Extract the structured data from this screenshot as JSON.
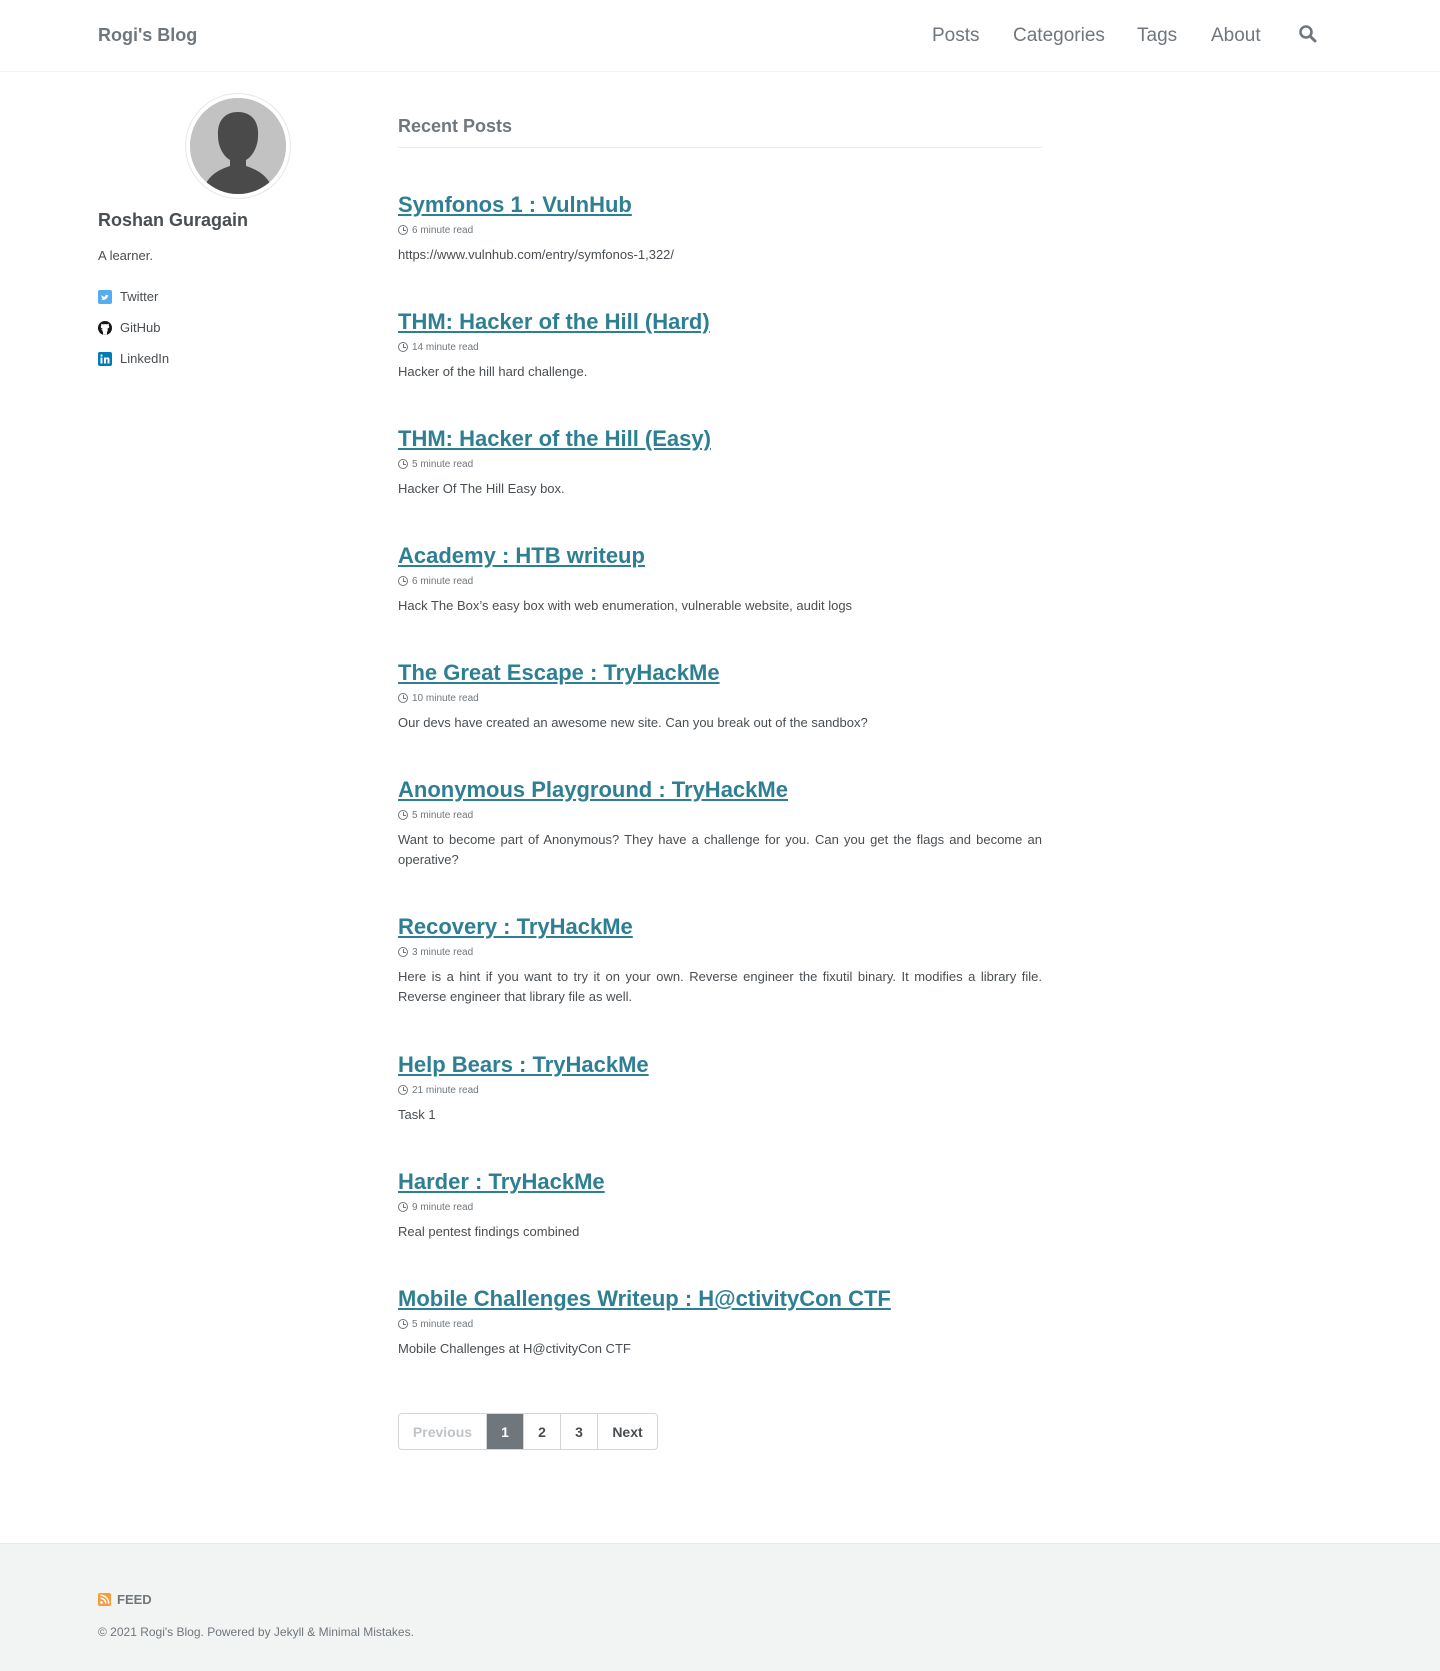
{
  "site": {
    "title": "Rogi's Blog"
  },
  "nav": {
    "items": [
      {
        "label": "Posts"
      },
      {
        "label": "Categories"
      },
      {
        "label": "Tags"
      },
      {
        "label": "About"
      }
    ],
    "search_icon": "search-icon"
  },
  "author": {
    "name": "Roshan Guragain",
    "bio": "A learner.",
    "links": [
      {
        "label": "Twitter",
        "icon": "twitter-icon",
        "color": "#55acee"
      },
      {
        "label": "GitHub",
        "icon": "github-icon",
        "color": "#171516"
      },
      {
        "label": "LinkedIn",
        "icon": "linkedin-icon",
        "color": "#007bb6"
      }
    ]
  },
  "main": {
    "heading": "Recent Posts",
    "posts": [
      {
        "title": "Symfonos 1 : VulnHub",
        "read_time": "6 minute read",
        "excerpt": "https://www.vulnhub.com/entry/symfonos-1,322/"
      },
      {
        "title": "THM: Hacker of the Hill (Hard)",
        "read_time": "14 minute read",
        "excerpt": "Hacker of the hill hard challenge."
      },
      {
        "title": "THM: Hacker of the Hill (Easy)",
        "read_time": "5 minute read",
        "excerpt": "Hacker Of The Hill Easy box."
      },
      {
        "title": "Academy : HTB writeup",
        "read_time": "6 minute read",
        "excerpt": "Hack The Box’s easy box with web enumeration, vulnerable website, audit logs"
      },
      {
        "title": "The Great Escape : TryHackMe",
        "read_time": "10 minute read",
        "excerpt": "Our devs have created an awesome new site. Can you break out of the sandbox?"
      },
      {
        "title": "Anonymous Playground : TryHackMe",
        "read_time": "5 minute read",
        "excerpt": "Want to become part of Anonymous? They have a challenge for you. Can you get the flags and become an operative?"
      },
      {
        "title": "Recovery : TryHackMe",
        "read_time": "3 minute read",
        "excerpt": "Here is a hint if you want to try it on your own. Reverse engineer the fixutil binary. It modifies a library file. Reverse engineer that library file as well."
      },
      {
        "title": "Help Bears : TryHackMe",
        "read_time": "21 minute read",
        "excerpt": "Task 1"
      },
      {
        "title": "Harder : TryHackMe",
        "read_time": "9 minute read",
        "excerpt": "Real pentest findings combined"
      },
      {
        "title": "Mobile Challenges Writeup : H@ctivityCon CTF",
        "read_time": "5 minute read",
        "excerpt": "Mobile Challenges at H@ctivityCon CTF"
      }
    ]
  },
  "pagination": {
    "previous": "Previous",
    "pages": [
      "1",
      "2",
      "3"
    ],
    "current": "1",
    "next": "Next"
  },
  "footer": {
    "feed_label": "FEED",
    "copyright": "© 2021 Rogi's Blog. Powered by Jekyll & Minimal Mistakes."
  },
  "colors": {
    "link": "#2f7f93",
    "text": "#494e52",
    "muted": "#6f777d",
    "rss": "#fa9b39"
  }
}
